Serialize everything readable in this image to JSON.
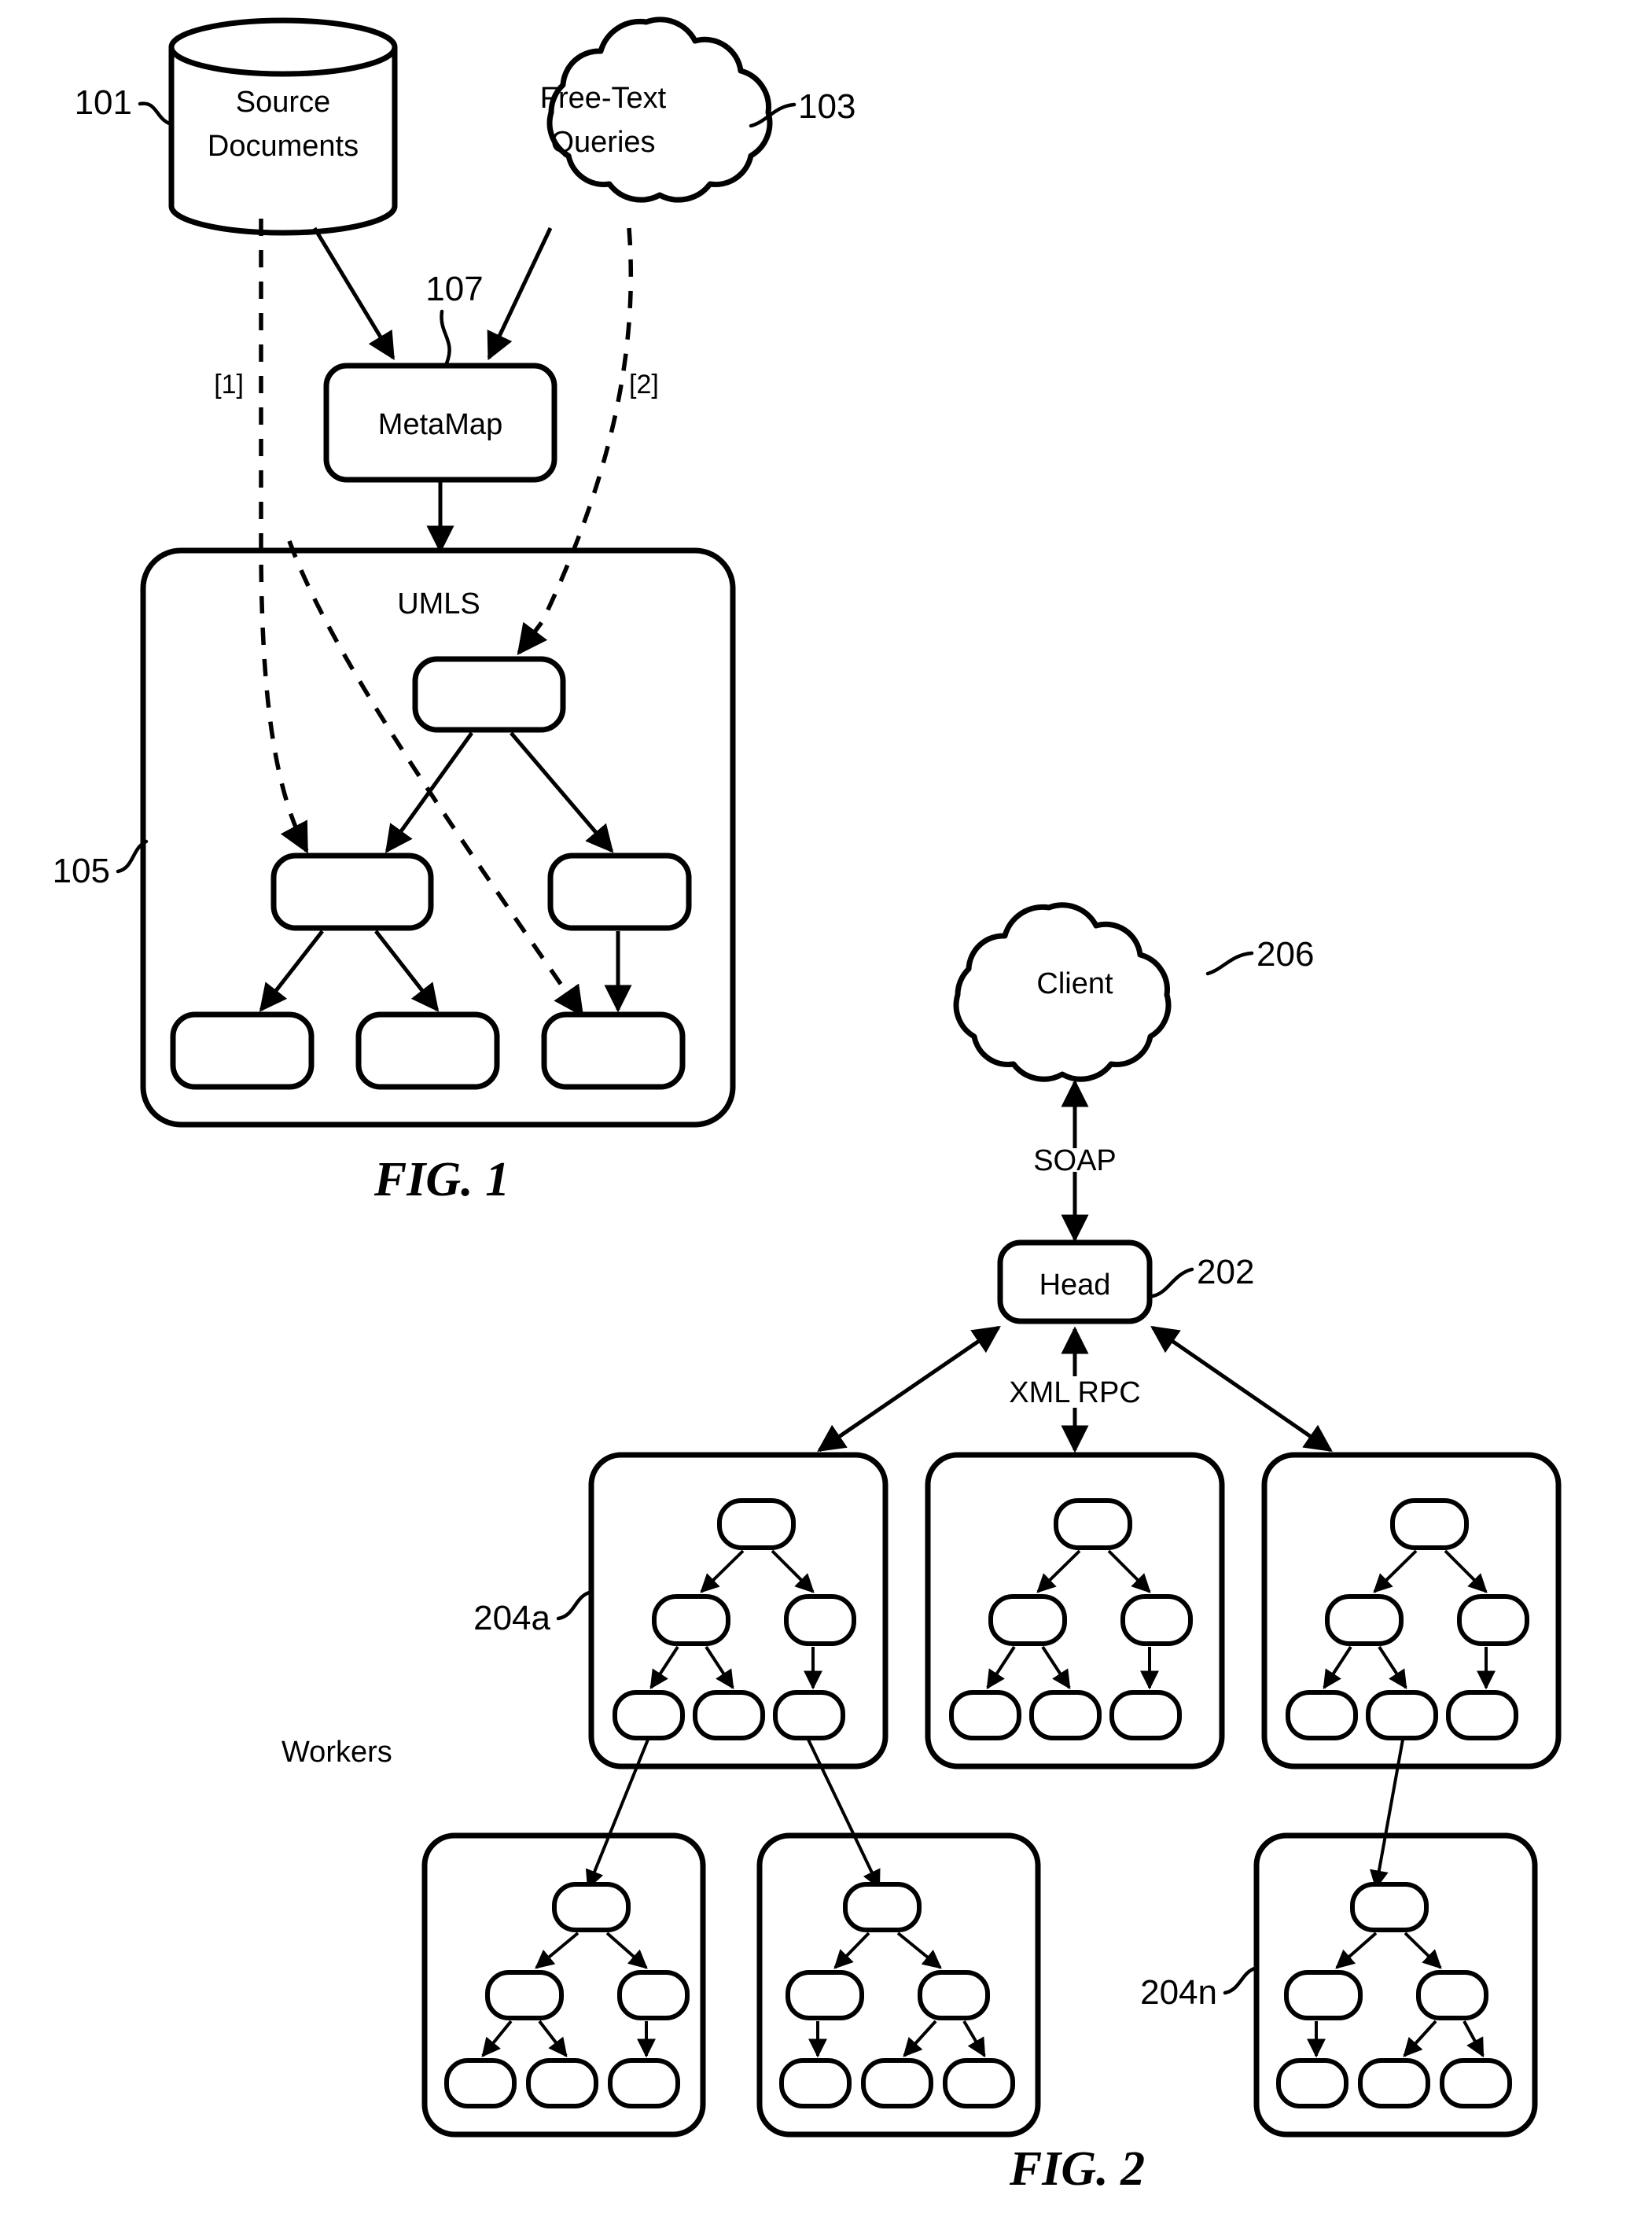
{
  "document": {
    "kind": "patent-drawing-sheet",
    "figures": [
      "FIG. 1",
      "FIG. 2"
    ]
  },
  "fig1": {
    "caption": "FIG. 1",
    "source_documents": {
      "label_line1": "Source",
      "label_line2": "Documents",
      "ref": "101"
    },
    "free_text_queries": {
      "label_line1": "Free-Text",
      "label_line2": "Queries",
      "ref": "103"
    },
    "metamap": {
      "label": "MetaMap",
      "ref": "107"
    },
    "umls": {
      "label": "UMLS",
      "ref": "105"
    },
    "path_labels": {
      "path1": "[1]",
      "path2": "[2]"
    }
  },
  "fig2": {
    "caption": "FIG. 2",
    "client": {
      "label": "Client",
      "ref": "206"
    },
    "head": {
      "label": "Head",
      "ref": "202"
    },
    "protocols": {
      "soap": "SOAP",
      "xmlrpc": "XML RPC"
    },
    "workers": {
      "group_label": "Workers",
      "first_ref": "204a",
      "last_ref": "204n"
    }
  }
}
